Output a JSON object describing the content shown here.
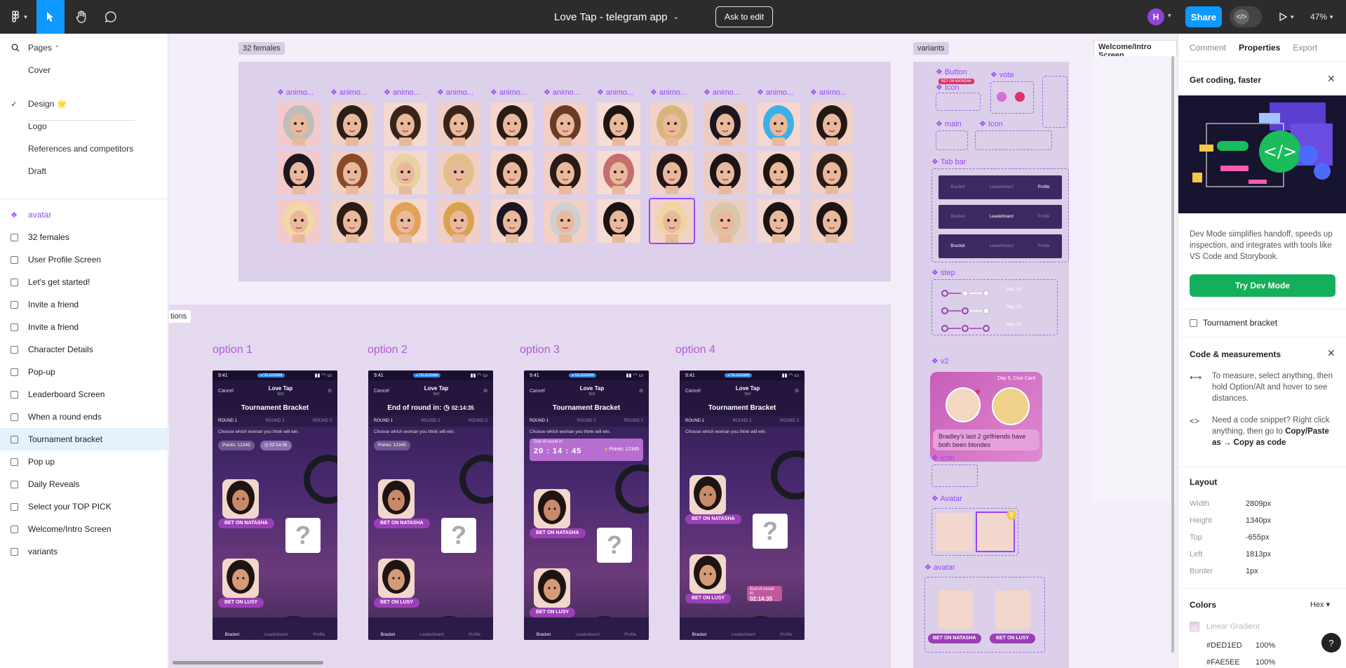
{
  "toolbar": {
    "title": "Love Tap - telegram app",
    "ask_to_edit": "Ask to edit",
    "avatar_initial": "H",
    "share": "Share",
    "dev_icon": "</>",
    "zoom": "47%"
  },
  "left": {
    "pages_label": "Pages",
    "pages": [
      "Cover",
      "Design 🌟",
      "Logo",
      "References and competitors",
      "Draft"
    ],
    "layers": [
      {
        "label": "avatar",
        "type": "component"
      },
      {
        "label": "32 females",
        "type": "frame"
      },
      {
        "label": "User Profile Screen",
        "type": "frame"
      },
      {
        "label": "Let's get started!",
        "type": "frame"
      },
      {
        "label": "Invite a friend",
        "type": "frame"
      },
      {
        "label": "Invite a friend",
        "type": "frame"
      },
      {
        "label": "Character Details",
        "type": "frame"
      },
      {
        "label": "Pop-up",
        "type": "frame"
      },
      {
        "label": "Leaderboard Screen",
        "type": "frame"
      },
      {
        "label": "When a round ends",
        "type": "frame"
      },
      {
        "label": "Tournament bracket",
        "type": "frame",
        "selected": true
      },
      {
        "label": "Pop up",
        "type": "frame"
      },
      {
        "label": "Daily Reveals",
        "type": "frame"
      },
      {
        "label": "Select your TOP PICK",
        "type": "frame"
      },
      {
        "label": "Welcome/Intro Screen",
        "type": "frame"
      },
      {
        "label": "variants",
        "type": "frame"
      }
    ]
  },
  "canvas": {
    "frame_32_label": "32 females",
    "variants_label": "variants",
    "intro_label": "Welcome/Intro Screen",
    "options_label_partial": "tions",
    "avatar_component_label": "animo...",
    "avatar_colors": [
      "#f3c9c9",
      "#f0d2c4",
      "#f3d9d0",
      "#f0cfc6",
      "#f5d6cf",
      "#f2d0c8",
      "#f7dcd4",
      "#f1d3ca",
      "#eccdc5",
      "#f4d7d1",
      "#f1d1c8"
    ],
    "options": [
      {
        "label": "option 1",
        "header": "Tournament Bracket",
        "variant": "points"
      },
      {
        "label": "option 2",
        "header": "End of round in:",
        "timer": "02:14:35",
        "variant": "header-timer"
      },
      {
        "label": "option 3",
        "header": "Tournament Bracket",
        "variant": "big-timer"
      },
      {
        "label": "option 4",
        "header": "Tournament Bracket",
        "variant": "bottom-timer"
      }
    ],
    "phone": {
      "time": "9:41",
      "pill": "◂ TELEGRAM",
      "cancel": "Cancel",
      "app": "Love Tap",
      "bot": "bot",
      "rounds": [
        "ROUND 1",
        "ROUND 2",
        "ROUND 3"
      ],
      "hint": "Choose which woman you think will win.",
      "points": "Points: 12345",
      "timer": "02:14:35",
      "end_of_round": "End of round in:",
      "digits": [
        "20",
        "14",
        "45"
      ],
      "bet1": "BET ON NATASHA",
      "bet2": "BET ON LUSY",
      "tabs": [
        "Bracket",
        "Leaderboard",
        "Profile"
      ]
    },
    "variants": {
      "button": "Button",
      "vote": "vote",
      "icon": "Icon",
      "main": "main",
      "icon2": "Icon",
      "tabbar": "Tab bar",
      "step": "step",
      "step_labels": [
        "Step 1/3",
        "Step 2/3",
        "Step 3/3"
      ],
      "v2": "v2",
      "v2_day": "Day 5, Clue Card",
      "v2_text": "Bradley's last 2 girlfriends have both been blondes",
      "icon3": "icon",
      "avatar_big": "Avatar",
      "avatar_small": "avatar",
      "bet_natasha": "BET ON NATASHA",
      "bet_lusy": "BET ON LUSY",
      "badge": "BET ON NATASHA"
    }
  },
  "right": {
    "tabs": [
      "Comment",
      "Properties",
      "Export"
    ],
    "promo_title": "Get coding, faster",
    "promo_text": "Dev Mode simplifies handoff, speeds up inspection, and integrates with tools like VS Code and Storybook.",
    "dev_button": "Try Dev Mode",
    "selection": "Tournament bracket",
    "code_title": "Code & measurements",
    "measure_text": "To measure, select anything, then hold Option/Alt and hover to see distances.",
    "snippet_text_a": "Need a code snippet? Right click anything, then go to ",
    "snippet_bold": "Copy/Paste as → Copy as code",
    "layout_title": "Layout",
    "layout": [
      {
        "k": "Width",
        "v": "2809px"
      },
      {
        "k": "Height",
        "v": "1340px"
      },
      {
        "k": "Top",
        "v": "-655px"
      },
      {
        "k": "Left",
        "v": "1813px"
      },
      {
        "k": "Border",
        "v": "1px"
      }
    ],
    "colors_title": "Colors",
    "hex_label": "Hex",
    "linear_gradient": "Linear Gradient",
    "colors": [
      {
        "hex": "#DED1ED",
        "pct": "100%"
      },
      {
        "hex": "#FAE5EE",
        "pct": "100%"
      }
    ],
    "help": "?"
  }
}
